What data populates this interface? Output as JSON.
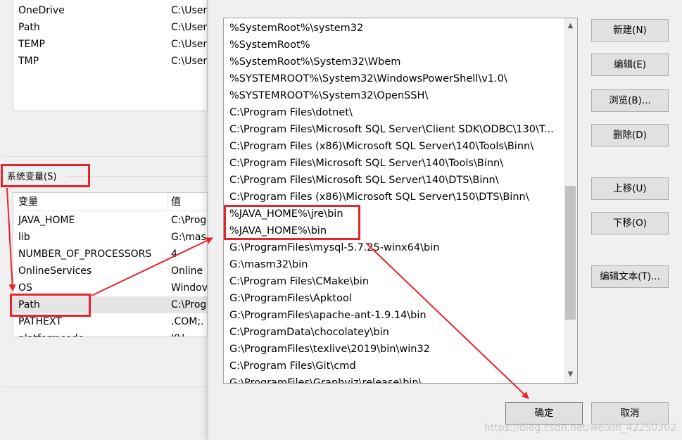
{
  "user_vars": {
    "rows": [
      {
        "name": "OneDrive",
        "value": "C:\\User"
      },
      {
        "name": "Path",
        "value": "C:\\User"
      },
      {
        "name": "TEMP",
        "value": "C:\\User"
      },
      {
        "name": "TMP",
        "value": "C:\\User"
      }
    ]
  },
  "system_vars": {
    "group_label": "系统变量(S)",
    "col_name": "变量",
    "col_value": "值",
    "rows": [
      {
        "name": "JAVA_HOME",
        "value": "C:\\Prog"
      },
      {
        "name": "lib",
        "value": "G:\\mas"
      },
      {
        "name": "NUMBER_OF_PROCESSORS",
        "value": "4"
      },
      {
        "name": "OnlineServices",
        "value": "Online"
      },
      {
        "name": "OS",
        "value": "Windov"
      },
      {
        "name": "Path",
        "value": "C:\\Prog"
      },
      {
        "name": "PATHEXT",
        "value": ".COM;."
      },
      {
        "name": "platformcode",
        "value": "KV"
      }
    ],
    "selected_index": 5
  },
  "edit_dialog": {
    "paths": [
      "%SystemRoot%\\system32",
      "%SystemRoot%",
      "%SystemRoot%\\System32\\Wbem",
      "%SYSTEMROOT%\\System32\\WindowsPowerShell\\v1.0\\",
      "%SYSTEMROOT%\\System32\\OpenSSH\\",
      "C:\\Program Files\\dotnet\\",
      "C:\\Program Files\\Microsoft SQL Server\\Client SDK\\ODBC\\130\\T...",
      "C:\\Program Files (x86)\\Microsoft SQL Server\\140\\Tools\\Binn\\",
      "C:\\Program Files\\Microsoft SQL Server\\140\\Tools\\Binn\\",
      "C:\\Program Files\\Microsoft SQL Server\\140\\DTS\\Binn\\",
      "C:\\Program Files (x86)\\Microsoft SQL Server\\150\\DTS\\Binn\\",
      "%JAVA_HOME%\\jre\\bin",
      "%JAVA_HOME%\\bin",
      "G:\\ProgramFiles\\mysql-5.7.25-winx64\\bin",
      "G:\\masm32\\bin",
      "C:\\Program Files\\CMake\\bin",
      "G:\\ProgramFiles\\Apktool",
      "G:\\ProgramFiles\\apache-ant-1.9.14\\bin",
      "C:\\ProgramData\\chocolatey\\bin",
      "G:\\ProgramFiles\\texlive\\2019\\bin\\win32",
      "C:\\Program Files\\Git\\cmd",
      "G:\\ProgramFiles\\Graphviz\\release\\bin\\"
    ],
    "buttons": {
      "new": "新建(N)",
      "edit": "编辑(E)",
      "browse": "浏览(B)...",
      "delete": "删除(D)",
      "move_up": "上移(U)",
      "move_down": "下移(O)",
      "edit_text": "编辑文本(T)...",
      "ok": "确定",
      "cancel": "取消"
    }
  },
  "annotation_color": "#e8232b",
  "watermark": "https://blog.csdn.net/weixin_42250302"
}
